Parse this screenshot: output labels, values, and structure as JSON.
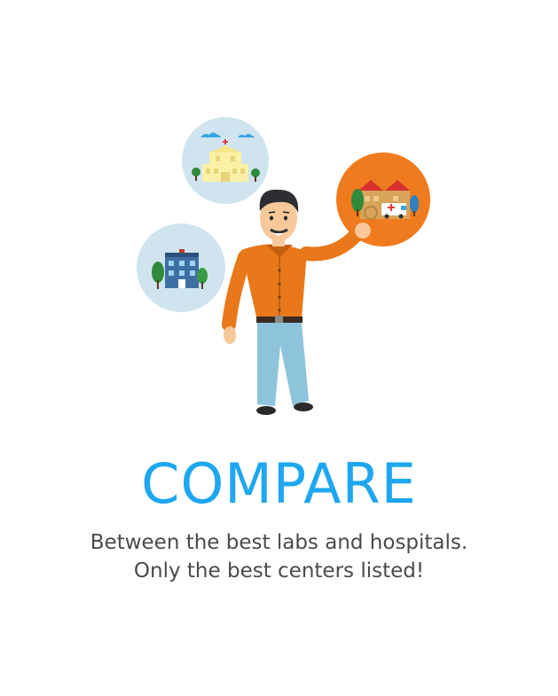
{
  "heading": "COMPARE",
  "description": {
    "line1": "Between the best labs and hospitals.",
    "line2": "Only the best centers listed!"
  },
  "colors": {
    "accent": "#1ea7f0",
    "circle_light": "#cfe4ef",
    "circle_highlight": "#f07b1e",
    "shirt": "#e8781a",
    "jeans": "#8ec3dc"
  },
  "illustration": {
    "icons": [
      "hospital-icon",
      "clinic-building-icon",
      "medical-center-icon",
      "ambulance-icon",
      "tree-icon"
    ]
  }
}
